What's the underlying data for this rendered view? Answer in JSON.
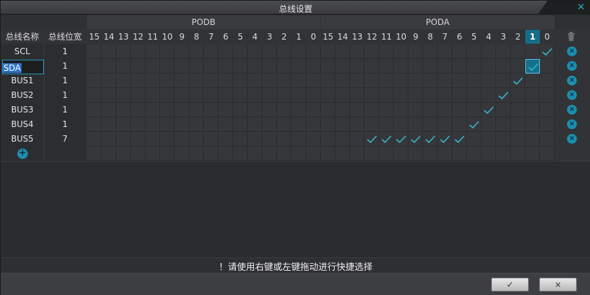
{
  "window": {
    "title": "总线设置",
    "close_icon": "×"
  },
  "groups": {
    "podb": "PODB",
    "poda": "PODA"
  },
  "columns": {
    "name_header": "总线名称",
    "width_header": "总线位宽",
    "podb_bits": [
      "15",
      "14",
      "13",
      "12",
      "11",
      "10",
      "9",
      "8",
      "7",
      "6",
      "5",
      "4",
      "3",
      "2",
      "1",
      "0"
    ],
    "poda_bits": [
      "15",
      "14",
      "13",
      "12",
      "11",
      "10",
      "9",
      "8",
      "7",
      "6",
      "5",
      "4",
      "3",
      "2",
      "1",
      "0"
    ]
  },
  "rows": [
    {
      "name": "SCL",
      "width": "1",
      "poda_checked": [
        "0"
      ]
    },
    {
      "name": "SDA",
      "width": "1",
      "poda_checked": [
        "1"
      ]
    },
    {
      "name": "BUS1",
      "width": "1",
      "poda_checked": [
        "2"
      ]
    },
    {
      "name": "BUS2",
      "width": "1",
      "poda_checked": [
        "3"
      ]
    },
    {
      "name": "BUS3",
      "width": "1",
      "poda_checked": [
        "4"
      ]
    },
    {
      "name": "BUS4",
      "width": "1",
      "poda_checked": [
        "5"
      ]
    },
    {
      "name": "BUS5",
      "width": "7",
      "poda_checked": [
        "12",
        "11",
        "10",
        "9",
        "8",
        "7",
        "6"
      ]
    }
  ],
  "editing_row_value": "SDA",
  "selected_poda_bit": "1",
  "icons": {
    "delete_icon": "×",
    "add_icon": "+",
    "trash_icon": "trash",
    "check_icon": "check"
  },
  "hint": "！请使用右键或左键拖动进行快捷选择",
  "buttons": {
    "ok_label": "✓",
    "cancel_label": "×"
  },
  "colors": {
    "accent": "#1c8fb0",
    "check": "#3ab6d2",
    "highlight": "#156d88"
  }
}
